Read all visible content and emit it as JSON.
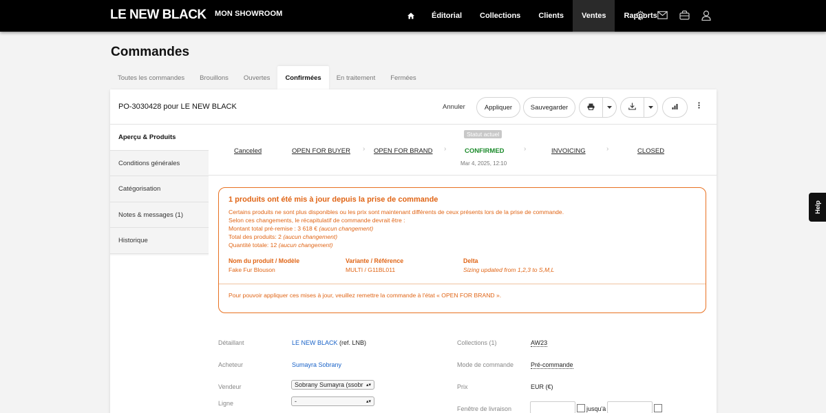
{
  "header": {
    "logo": "LE NEW BLACK",
    "showroom": "MON SHOWROOM",
    "nav": [
      "Éditorial",
      "Collections",
      "Clients",
      "Ventes",
      "Rapports"
    ],
    "active_nav": "Ventes",
    "icons": [
      "home-icon",
      "settings-icon",
      "mail-icon",
      "bag-icon",
      "user-icon"
    ]
  },
  "page": {
    "title": "Commandes"
  },
  "tabs": {
    "items": [
      "Toutes les commandes",
      "Brouillons",
      "Ouvertes",
      "Confirmées",
      "En traitement",
      "Fermées"
    ],
    "active": "Confirmées"
  },
  "order": {
    "title": "PO-3030428 pour LE NEW BLACK",
    "actions": {
      "cancel": "Annuler",
      "apply": "Appliquer",
      "save": "Sauvegarder"
    }
  },
  "sidebar": {
    "items": [
      "Aperçu & Produits",
      "Conditions générales",
      "Catégorisation",
      "Notes & messages (1)",
      "Historique"
    ],
    "active": "Aperçu & Produits"
  },
  "status": {
    "badge": "Statut actuel",
    "stages": [
      "Canceled",
      "OPEN FOR BUYER",
      "OPEN FOR BRAND",
      "CONFIRMED",
      "INVOICING",
      "CLOSED"
    ],
    "current": "CONFIRMED",
    "date": "Mar 4, 2025, 12:10"
  },
  "alert": {
    "title": "1 produits ont été mis à jour depuis la prise de commande",
    "line1": "Certains produits ne sont plus disponibles ou les prix sont maintenant différents de ceux présents lors de la prise de commande.",
    "line2": "Selon ces changements, le récapitulatif de commande devrait être :",
    "total_label": "Montant total pré-remise : 3 618 €",
    "products_label": "Total des produits: 2",
    "qty_label": "Quantité totale: 12",
    "no_change": "(aucun changement)",
    "columns": [
      "Nom du produit / Modèle",
      "Variante / Référence",
      "Delta"
    ],
    "row": {
      "product": "Fake Fur Blouson",
      "variant": "MULTI / G11BL011",
      "delta": "Sizing updated from 1,2,3 to S,M,L"
    },
    "footer": "Pour pouvoir appliquer ces mises à jour, veuillez remettre la commande à l'état « OPEN FOR BRAND »."
  },
  "details": {
    "retailer_label": "Détaillant",
    "retailer_value": "LE NEW BLACK",
    "retailer_ref": "(ref. LNB)",
    "buyer_label": "Acheteur",
    "buyer_value": "Sumayra Sobrany",
    "seller_label": "Vendeur",
    "seller_value": "Sobrany Sumayra (ssobr",
    "line_label": "Ligne",
    "line_value": "-",
    "collections_label": "Collections (1)",
    "collections_value": "AW23",
    "mode_label": "Mode de commande",
    "mode_value": "Pré-commande",
    "price_label": "Prix",
    "price_value": "EUR (€)",
    "window_label": "Fenêtre de livraison",
    "window_until": "jusqu'à"
  },
  "help": "Help"
}
